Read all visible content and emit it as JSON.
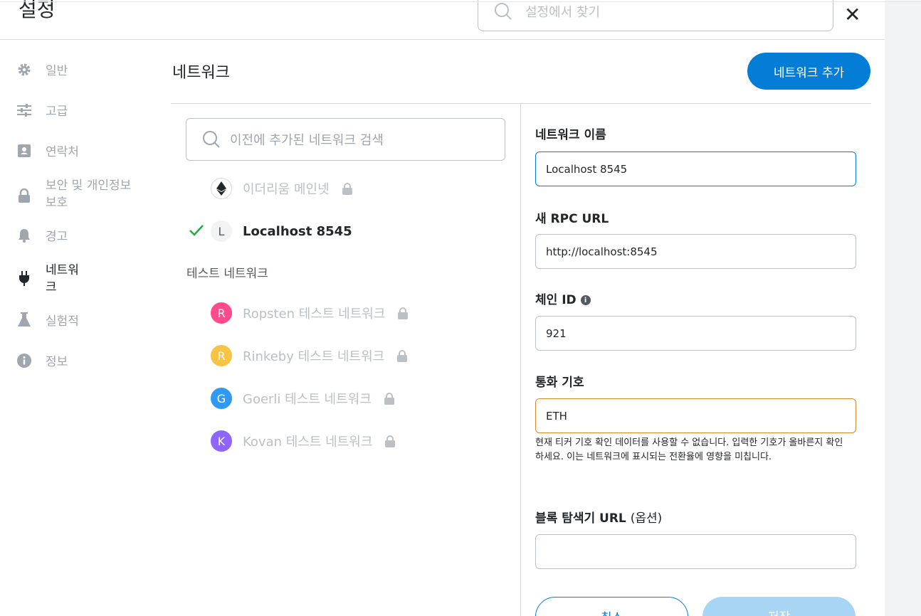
{
  "header": {
    "title": "설정",
    "search_placeholder": "설정에서 찾기",
    "close_glyph": "✕"
  },
  "sidebar": {
    "items": [
      {
        "label": "일반",
        "icon": "gear-icon"
      },
      {
        "label": "고급",
        "icon": "sliders-icon"
      },
      {
        "label": "연락처",
        "icon": "contact-book-icon"
      },
      {
        "label": "보안 및 개인정보\n보호",
        "icon": "lock-icon"
      },
      {
        "label": "경고",
        "icon": "bell-icon"
      },
      {
        "label": "네트워\n크",
        "icon": "plug-icon",
        "active": true
      },
      {
        "label": "실험적",
        "icon": "flask-icon"
      },
      {
        "label": "정보",
        "icon": "info-icon"
      }
    ]
  },
  "networks": {
    "title": "네트워크",
    "add_button": "네트워크 추가",
    "search_placeholder": "이전에 추가된 네트워크 검색",
    "main": [
      {
        "label": "이더리움 메인넷",
        "avatar": "eth",
        "locked": true
      },
      {
        "label": "Localhost 8545",
        "avatar": "L",
        "selected": true
      }
    ],
    "test_heading": "테스트 네트워크",
    "test": [
      {
        "label": "Ropsten 테스트 네트워크",
        "avatar": "R",
        "color": "#ff4a8d"
      },
      {
        "label": "Rinkeby 테스트 네트워크",
        "avatar": "R",
        "color": "#f6c343"
      },
      {
        "label": "Goerli 테스트 네트워크",
        "avatar": "G",
        "color": "#3099f2"
      },
      {
        "label": "Kovan 테스트 네트워크",
        "avatar": "K",
        "color": "#9064ff"
      }
    ]
  },
  "form": {
    "name_label": "네트워크 이름",
    "name_value": "Localhost 8545",
    "rpc_label": "새 RPC URL",
    "rpc_value": "http://localhost:8545",
    "chain_label": "체인 ID",
    "chain_value": "921",
    "symbol_label": "통화 기호",
    "symbol_value": "ETH",
    "symbol_warning": "현재 티커 기호 확인 데이터를 사용할 수 없습니다. 입력한 기호가 올바른지 확인하세요. 이는 네트워크에 표시되는 전환율에 영향을 미칩니다.",
    "explorer_label": "블록 탐색기 URL",
    "explorer_optional": "(옵션)",
    "explorer_value": "",
    "cancel_button": "취소",
    "save_button": "저장"
  },
  "colors": {
    "accent": "#037dd6",
    "warning_border": "#d7882f",
    "check": "#28a745"
  }
}
